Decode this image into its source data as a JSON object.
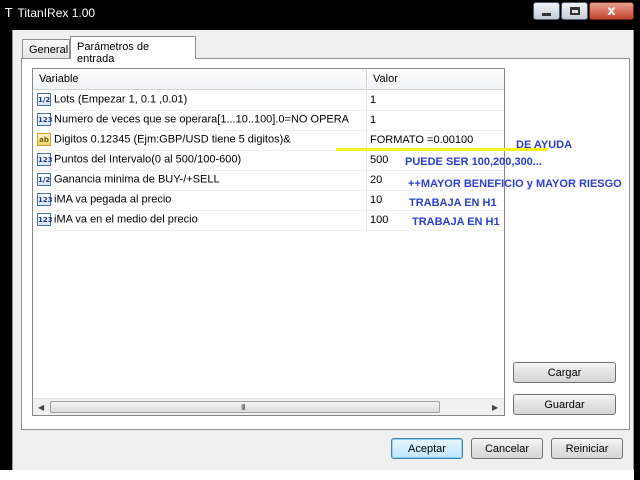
{
  "window": {
    "title": "TitanIRex 1.00",
    "title_mark": "T"
  },
  "tabs": [
    {
      "label": "General"
    },
    {
      "label": "Parámetros de entrada"
    }
  ],
  "grid": {
    "headers": {
      "variable": "Variable",
      "value": "Valor"
    },
    "rows": [
      {
        "icon": "1/2",
        "type": "double",
        "variable": "Lots (Empezar 1, 0.1 ,0.01)",
        "value": "1"
      },
      {
        "icon": "123",
        "type": "int",
        "variable": "Numero de veces que se operara[1...10..100].0=NO OPERA",
        "value": "1"
      },
      {
        "icon": "ab",
        "type": "string",
        "variable": "Digitos 0.12345 (Ejm:GBP/USD tiene 5 digitos)&",
        "value": "FORMATO =0.00100"
      },
      {
        "icon": "123",
        "type": "int",
        "variable": "Puntos del Intervalo(0 al 500/100-600)",
        "value": "500"
      },
      {
        "icon": "1/2",
        "type": "double",
        "variable": "Ganancia minima de BUY-/+SELL",
        "value": "20"
      },
      {
        "icon": "123",
        "type": "int",
        "variable": "iMA va pegada al precio",
        "value": "10"
      },
      {
        "icon": "123",
        "type": "int",
        "variable": "iMA va en el medio del precio",
        "value": "100"
      }
    ],
    "scrollbar": {
      "left": "◀",
      "right": "▶",
      "grip": "III"
    }
  },
  "annotations": {
    "ayuda": "DE AYUDA",
    "puede_ser": "PUEDE SER 100,200,300...",
    "mayor": "++MAYOR BENEFICIO y MAYOR RIESGO",
    "h1_a": "TRABAJA EN H1",
    "h1_b": "TRABAJA EN H1",
    "highlight_color": "#f7ef1e",
    "text_color": "#2b3fd1"
  },
  "buttons": {
    "cargar": "Cargar",
    "guardar": "Guardar",
    "aceptar": "Aceptar",
    "cancelar": "Cancelar",
    "reiniciar": "Reiniciar",
    "close_glyph": "x"
  }
}
